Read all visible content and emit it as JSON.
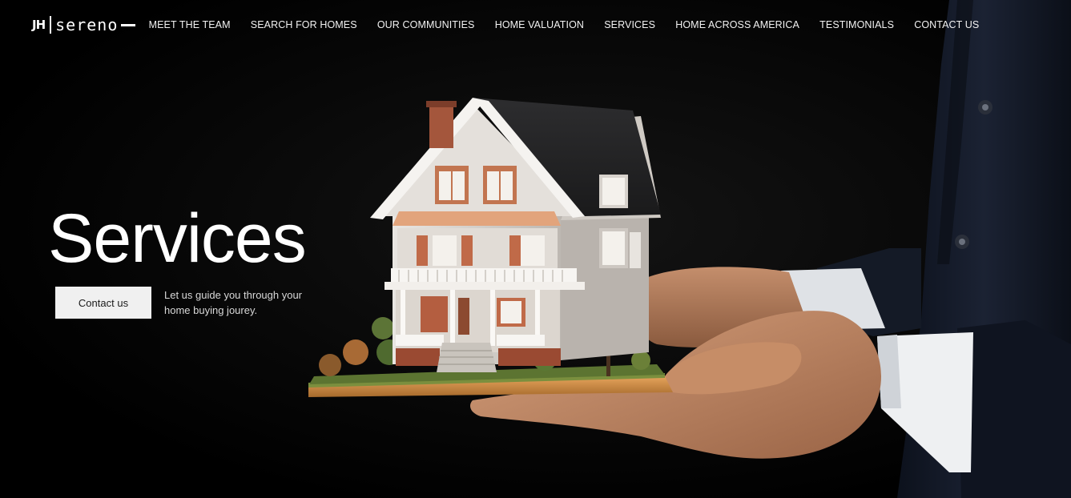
{
  "logo": {
    "monogram": "JH",
    "wordmark": "sereno"
  },
  "nav": {
    "items": [
      {
        "label": "MEET THE TEAM"
      },
      {
        "label": "SEARCH FOR HOMES"
      },
      {
        "label": "OUR COMMUNITIES"
      },
      {
        "label": "HOME VALUATION"
      },
      {
        "label": "SERVICES"
      },
      {
        "label": "HOME ACROSS AMERICA"
      },
      {
        "label": "TESTIMONIALS"
      },
      {
        "label": "CONTACT US"
      }
    ]
  },
  "hero": {
    "title": "Services",
    "cta_label": "Contact us",
    "tagline": "Let us guide you through your home buying jourey.",
    "image": "hands-holding-house-model"
  },
  "colors": {
    "background": "#000000",
    "text": "#ffffff",
    "button_bg": "#f0f0f0",
    "button_text": "#1a1a1a"
  }
}
